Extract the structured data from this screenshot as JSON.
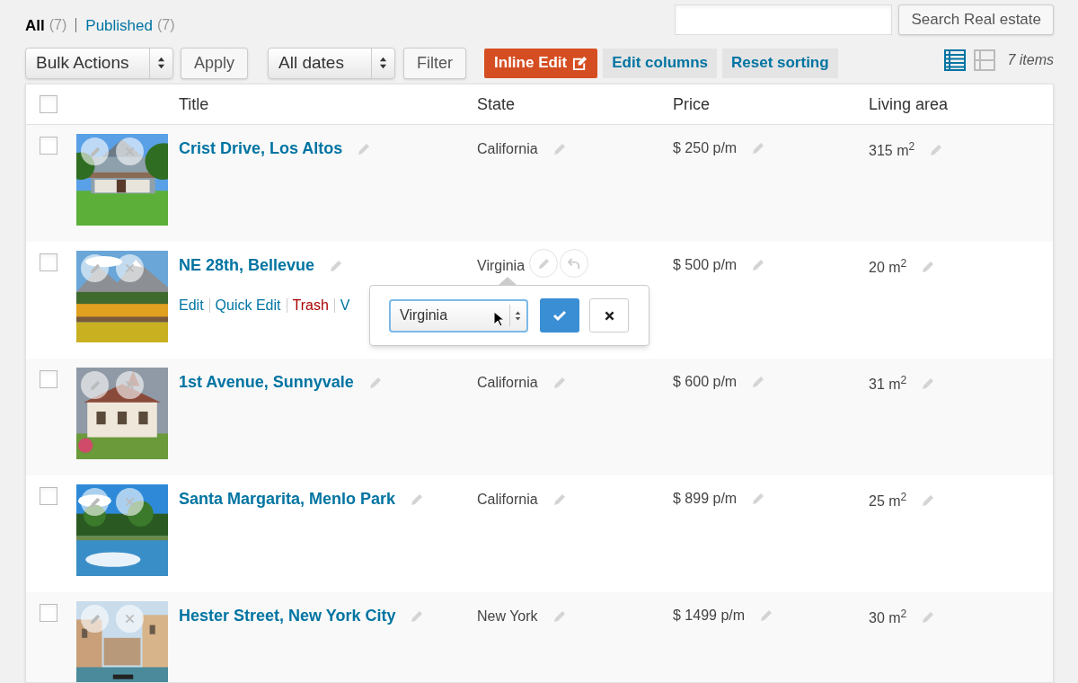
{
  "filters": [
    {
      "label": "All",
      "count": "(7)",
      "selected": true
    },
    {
      "label": "Published",
      "count": "(7)",
      "selected": false
    }
  ],
  "search": {
    "button": "Search Real estate"
  },
  "toolbar": {
    "bulk_actions": "Bulk Actions",
    "apply": "Apply",
    "dates": "All dates",
    "filter": "Filter",
    "inline_edit": "Inline Edit",
    "edit_columns": "Edit columns",
    "reset_sorting": "Reset sorting"
  },
  "views": [
    {
      "kind": "list",
      "selected": true
    },
    {
      "kind": "excerpt",
      "selected": false
    }
  ],
  "item_count": "7 items",
  "table": {
    "header_checked": false,
    "columns": [
      "Title",
      "State",
      "Price",
      "Living area"
    ],
    "rows": [
      {
        "checked": false,
        "title": "Crist Drive, Los Altos",
        "state": "California",
        "price": "$ 250 p/m",
        "area": "315 m$^{2}$",
        "editing": false
      },
      {
        "checked": false,
        "title": "NE 28th, Bellevue",
        "state": "Virginia",
        "price": "$ 500 p/m",
        "area": "20 m$^{2}$",
        "editing": true,
        "actions": [
          {
            "label": "Edit",
            "kind": "link"
          },
          {
            "label": "Quick Edit",
            "kind": "link"
          },
          {
            "label": "Trash",
            "kind": "danger"
          },
          {
            "label": "V",
            "kind": "link"
          }
        ],
        "editor": {
          "value": "Virginia"
        }
      },
      {
        "checked": false,
        "title": "1st Avenue, Sunnyvale",
        "state": "California",
        "price": "$ 600 p/m",
        "area": "31 m$^{2}$",
        "editing": false
      },
      {
        "checked": false,
        "title": "Santa Margarita, Menlo Park",
        "state": "California",
        "price": "$ 899 p/m",
        "area": "25 m$^{2}$",
        "editing": false
      },
      {
        "checked": false,
        "title": "Hester Street, New York City",
        "state": "New York",
        "price": "$ 1499 p/m",
        "area": "30 m$^{2}$",
        "editing": false
      }
    ]
  }
}
